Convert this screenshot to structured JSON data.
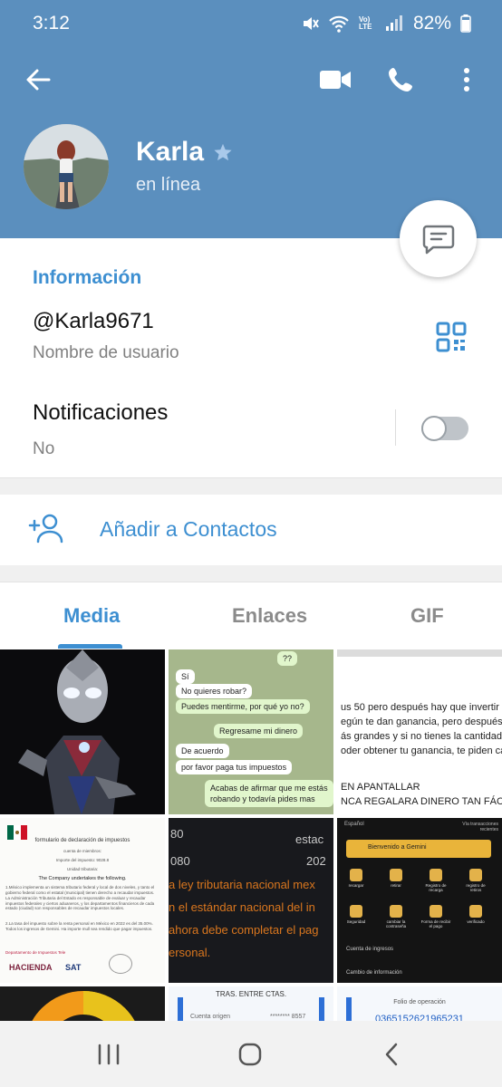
{
  "status_bar": {
    "time": "3:12",
    "battery": "82%",
    "volte": "Vo) LTE"
  },
  "toolbar": {
    "back_icon": "arrow-left-icon",
    "video_icon": "video-camera-icon",
    "call_icon": "phone-icon",
    "more_icon": "more-vertical-icon"
  },
  "profile": {
    "name": "Karla",
    "status": "en línea",
    "star_icon": "star-icon"
  },
  "info": {
    "title": "Información",
    "username": "@Karla9671",
    "username_caption": "Nombre de usuario",
    "notifications_title": "Notificaciones",
    "notifications_value": "No",
    "notifications_enabled": false
  },
  "actions": {
    "add_contact": "Añadir a Contactos"
  },
  "tabs": [
    {
      "label": "Media",
      "active": true
    },
    {
      "label": "Enlaces",
      "active": false
    },
    {
      "label": "GIF",
      "active": false
    }
  ],
  "media": {
    "chat": {
      "m1": "??",
      "m2": "Sí",
      "m3": "No quieres robar?",
      "m4": "Puedes mentirme, por qué yo no?",
      "m5": "Regresame mi dinero",
      "m6": "De acuerdo",
      "m7": "por favor paga tus impuestos",
      "m8": "Acabas de afirmar que me estás",
      "m9": "robando y todavía pides mas"
    },
    "doc": {
      "l1": "us 50 pero después hay que invertir p",
      "l2": "egún te dan ganancia,  pero después",
      "l3": "ás grandes y si no tienes la cantidad d",
      "l4": "oder obtener tu ganancia,  te piden ca",
      "l5": "EN APANTALLAR",
      "l6": "NCA REGALARA DINERO TAN FÁCIL"
    },
    "form": {
      "title": "formulario de declaración de impuestos",
      "account": "cuenta de miembros:",
      "amount": "Importe del impuesto: 9028.8",
      "unit": "Unidad tributaria:",
      "statement": "The Company undertakes the following.",
      "body": "1.México implementa un sistema tributario federal y local de dos niveles, y tanto el gobierno federal como el estatal (municipal) tienen derecho a recaudar impuestos. La Administración Tributaria del Estado es responsable de evaluar y recaudar impuestos federales y ciertos aduaneros, y los departamentos financieros de cada estado (ciudad) son responsables de recaudar impuestos locales.",
      "body2": "2.La tasa del impuesto sobre la renta personal en México en 2022 es del 35.00%. Todos los ingresos de Gemini. Ha importe mull sea rendido que pagar impuestos.",
      "footer_left": "HACIENDA",
      "footer_right": "SAT",
      "dept": "Departamento de Impuestos Tele"
    },
    "tax": {
      "n1": "80",
      "n2": "estac",
      "n3": "080",
      "n4": "202",
      "l1": "a ley tributaria nacional mex",
      "l2": "n el estándar nacional del in",
      "l3": "ahora debe completar el pag",
      "l4": "ersonal."
    },
    "app": {
      "header_left": "Español",
      "header_right": "Vía transacciones recientes",
      "banner": "Bienvenido a Gemini",
      "items": [
        "recargar",
        "retirar",
        "Registro de recarga",
        "registro de retiros",
        "Seguridad",
        "cambiar la contraseña",
        "Forma de recibir el pago",
        "verificado"
      ],
      "row1": "Cuenta de ingresos",
      "row2": "Cambio de información"
    },
    "transfer": {
      "title": "TRAS. ENTRE CTAS.",
      "row": "Cuenta origen",
      "value": "******** 8557"
    },
    "folio": {
      "title": "Folio de operación",
      "value": "0365152621965231"
    }
  },
  "navbar": {
    "recents_icon": "recent-apps-icon",
    "home_icon": "home-icon",
    "back_icon": "back-chevron-icon"
  },
  "colors": {
    "header": "#5b8fbe",
    "accent": "#3d8fd1",
    "muted": "#808080"
  }
}
